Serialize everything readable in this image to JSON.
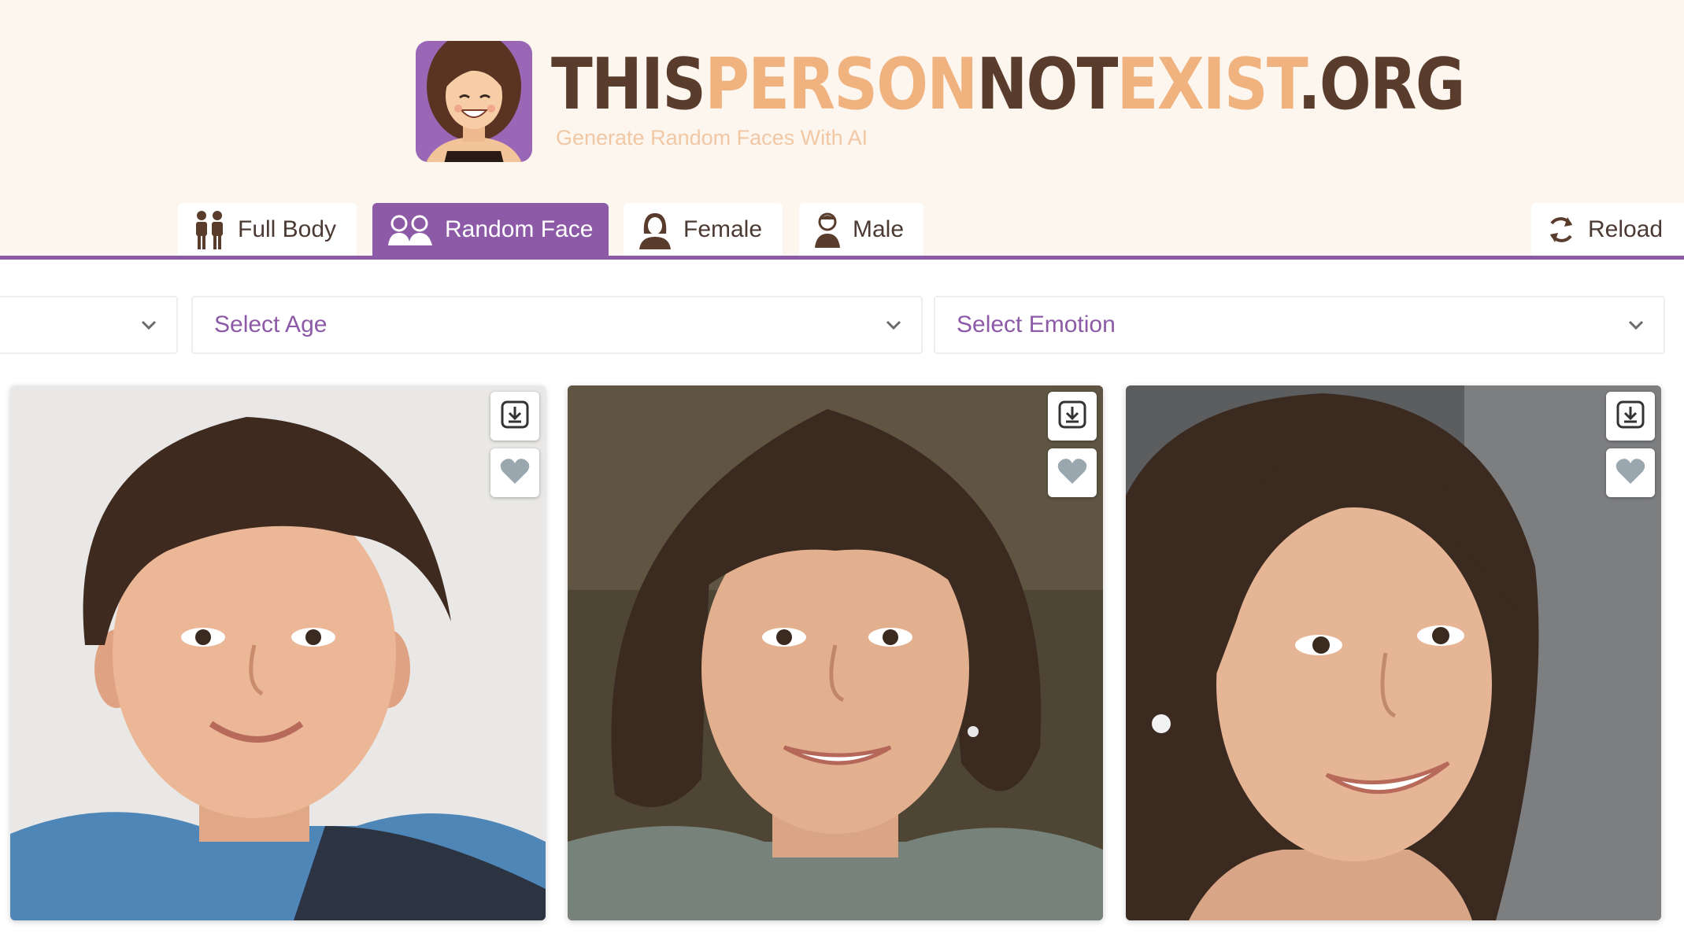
{
  "brand": {
    "part1": "THIS",
    "part2": "PERSON",
    "part3": "NOT",
    "part4": "EXIST",
    "part5": ".ORG",
    "tagline": "Generate Random Faces With AI",
    "colors": {
      "dark": "#5a3c2c",
      "light": "#f0b27e",
      "accent": "#8c5aa6"
    }
  },
  "tabs": [
    {
      "label": "Full Body",
      "icon": "two-people-icon",
      "active": false
    },
    {
      "label": "Random Face",
      "icon": "faces-group-icon",
      "active": true
    },
    {
      "label": "Female",
      "icon": "female-avatar-icon",
      "active": false
    },
    {
      "label": "Male",
      "icon": "male-avatar-icon",
      "active": false
    }
  ],
  "reload": {
    "label": "Reload",
    "icon": "reload-icon"
  },
  "filters": {
    "first": {
      "label": ""
    },
    "age": {
      "label": "Select Age"
    },
    "emotion": {
      "label": "Select Emotion"
    }
  },
  "cards": [
    {
      "subject": "child-portrait",
      "actions": [
        "download-icon",
        "heart-icon"
      ]
    },
    {
      "subject": "woman-portrait",
      "actions": [
        "download-icon",
        "heart-icon"
      ]
    },
    {
      "subject": "young-woman-portrait",
      "actions": [
        "download-icon",
        "heart-icon"
      ]
    }
  ]
}
